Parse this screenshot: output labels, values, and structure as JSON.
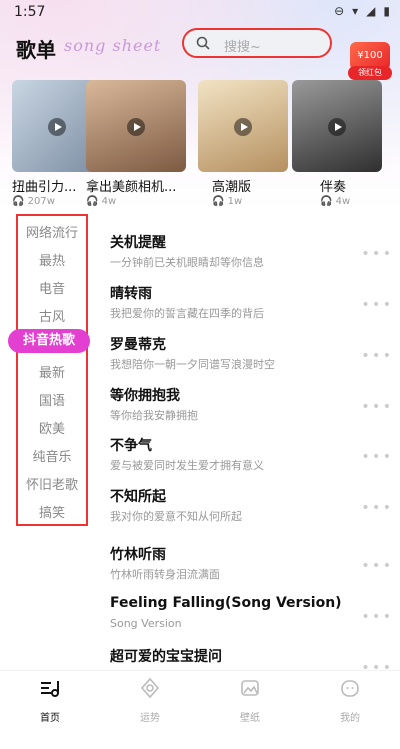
{
  "status_bar": {
    "time": "1:57",
    "battery_icon": "battery-icon",
    "wifi_icon": "wifi-icon"
  },
  "header": {
    "title": "歌单",
    "subtitle": "song sheet"
  },
  "search": {
    "placeholder": "搜搜~"
  },
  "red_badge": {
    "amount": "¥100",
    "label": "领红包"
  },
  "featured": [
    {
      "name": "扭曲引力...",
      "count": "207w",
      "color": "#8fa7c0"
    },
    {
      "name": "拿出美颜相机...",
      "count": "4w",
      "color": "#b58c74"
    },
    {
      "name": "高潮版",
      "count": "1w",
      "color": "#c9b08a"
    },
    {
      "name": "伴奏",
      "count": "4w",
      "color": "#5a5a5a"
    }
  ],
  "categories": [
    {
      "label": "网络流行",
      "active": false
    },
    {
      "label": "最热",
      "active": false
    },
    {
      "label": "电音",
      "active": false
    },
    {
      "label": "古风",
      "active": false
    },
    {
      "label": "抖音热歌",
      "active": true
    },
    {
      "label": "最新",
      "active": false
    },
    {
      "label": "国语",
      "active": false
    },
    {
      "label": "欧美",
      "active": false
    },
    {
      "label": "纯音乐",
      "active": false
    },
    {
      "label": "怀旧老歌",
      "active": false
    },
    {
      "label": "搞笑",
      "active": false
    }
  ],
  "songs": [
    {
      "title": "关机提醒",
      "subtitle": "一分钟前已关机眼睛却等你信息"
    },
    {
      "title": "晴转雨",
      "subtitle": "我把爱你的誓言藏在四季的背后"
    },
    {
      "title": "罗曼蒂克",
      "subtitle": "我想陪你一朝一夕同谱写浪漫时空"
    },
    {
      "title": "等你拥抱我",
      "subtitle": "等你给我安静拥抱"
    },
    {
      "title": "不争气",
      "subtitle": "爱与被爱同时发生爱才拥有意义"
    },
    {
      "title": "不知所起",
      "subtitle": "我对你的爱意不知从何所起"
    },
    {
      "title": "竹林听雨",
      "subtitle": "竹林听雨转身泪流满面"
    },
    {
      "title": "Feeling Falling(Song Version)",
      "subtitle": "Song Version"
    },
    {
      "title": "超可爱的宝宝提问",
      "subtitle": ""
    }
  ],
  "tabs": [
    {
      "label": "首页",
      "active": true
    },
    {
      "label": "运势",
      "active": false
    },
    {
      "label": "壁纸",
      "active": false
    },
    {
      "label": "我的",
      "active": false
    }
  ]
}
